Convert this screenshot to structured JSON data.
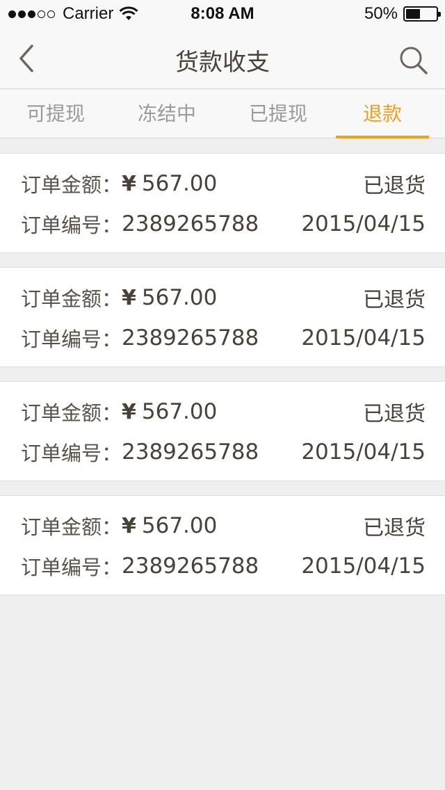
{
  "status_bar": {
    "carrier": "Carrier",
    "time": "8:08 AM",
    "battery": "50%"
  },
  "navbar": {
    "title": "货款收支",
    "back_icon": "chevron-left-icon",
    "search_icon": "search-icon"
  },
  "tabs": [
    {
      "label": "可提现",
      "active": false
    },
    {
      "label": "冻结中",
      "active": false
    },
    {
      "label": "已提现",
      "active": false
    },
    {
      "label": "退款",
      "active": true
    }
  ],
  "colors": {
    "accent": "#f0a11a",
    "background": "#efefef",
    "text": "#4a4238"
  },
  "records": [
    {
      "amount_label": "订单金额：",
      "currency": "¥",
      "amount": "567.00",
      "status": "已退货",
      "order_label": "订单编号：",
      "order_no": "2389265788",
      "date": "2015/04/15"
    },
    {
      "amount_label": "订单金额：",
      "currency": "¥",
      "amount": "567.00",
      "status": "已退货",
      "order_label": "订单编号：",
      "order_no": "2389265788",
      "date": "2015/04/15"
    },
    {
      "amount_label": "订单金额：",
      "currency": "¥",
      "amount": "567.00",
      "status": "已退货",
      "order_label": "订单编号：",
      "order_no": "2389265788",
      "date": "2015/04/15"
    },
    {
      "amount_label": "订单金额：",
      "currency": "¥",
      "amount": "567.00",
      "status": "已退货",
      "order_label": "订单编号：",
      "order_no": "2389265788",
      "date": "2015/04/15"
    }
  ]
}
